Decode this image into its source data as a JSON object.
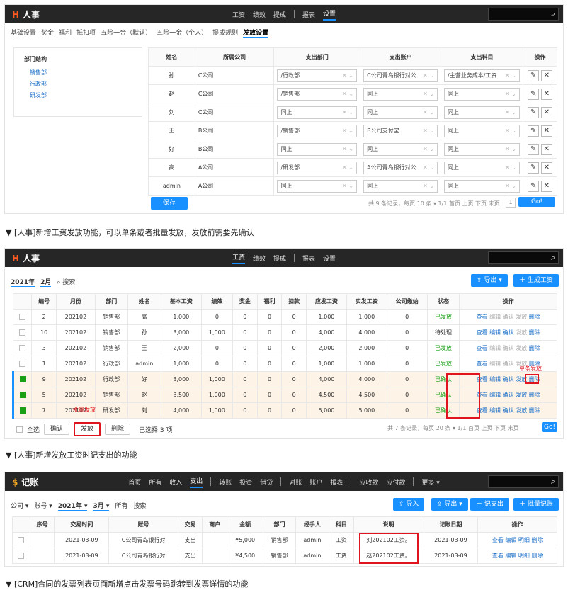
{
  "p1": {
    "logo": "人事",
    "nav": [
      "工资",
      "绩效",
      "提成",
      "报表",
      "设置"
    ],
    "active": "设置",
    "subtabs": [
      "基础设置",
      "奖金",
      "福利",
      "抵扣项",
      "五险一金（默认）",
      "五险一金（个人）",
      "提成规则",
      "发放设置"
    ],
    "active_tab": "发放设置",
    "tree_title": "部门结构",
    "tree_items": [
      "销售部",
      "行政部",
      "研发部"
    ],
    "headers": [
      "姓名",
      "所属公司",
      "支出部门",
      "支出账户",
      "支出科目",
      "操作"
    ],
    "rows": [
      [
        "孙",
        "C公司",
        "/行政部",
        "C公司青岛银行对公",
        "/主营业务成本/工资"
      ],
      [
        "赵",
        "C公司",
        "/销售部",
        "同上",
        "同上"
      ],
      [
        "刘",
        "C公司",
        "同上",
        "同上",
        "同上"
      ],
      [
        "王",
        "B公司",
        "/销售部",
        "B公司支付宝",
        "同上"
      ],
      [
        "好",
        "B公司",
        "同上",
        "同上",
        "同上"
      ],
      [
        "高",
        "A公司",
        "/研发部",
        "A公司青岛银行对公",
        "同上"
      ],
      [
        "admin",
        "A公司",
        "同上",
        "同上",
        "同上"
      ]
    ],
    "save": "保存",
    "pager": "共 9 条记录，每页 10 条 ▾ 1/1  首页 上页 下页 末页",
    "page_no": "1",
    "go": "Go!"
  },
  "cap1": "▼ [人事]新增工资发放功能，可以单条或者批量发放，发放前需要先确认",
  "p2": {
    "logo": "人事",
    "nav": [
      "工资",
      "绩效",
      "提成",
      "报表",
      "设置"
    ],
    "active": "工资",
    "year": "2021年",
    "month": "2月",
    "search": "搜索",
    "export": "导出",
    "generate": "生成工资",
    "headers": [
      "编号",
      "月份",
      "部门",
      "姓名",
      "基本工资",
      "绩效",
      "奖金",
      "福利",
      "扣款",
      "应发工资",
      "实发工资",
      "公司缴纳",
      "状态",
      "操作"
    ],
    "rows": [
      [
        "2",
        "202102",
        "销售部",
        "高",
        "1,000",
        "0",
        "0",
        "0",
        "0",
        "1,000",
        "1,000",
        "0",
        "已发放"
      ],
      [
        "10",
        "202102",
        "销售部",
        "孙",
        "3,000",
        "1,000",
        "0",
        "0",
        "0",
        "4,000",
        "4,000",
        "0",
        "待处理"
      ],
      [
        "3",
        "202102",
        "销售部",
        "王",
        "2,000",
        "0",
        "0",
        "0",
        "0",
        "2,000",
        "2,000",
        "0",
        "已发放"
      ],
      [
        "1",
        "202102",
        "行政部",
        "admin",
        "1,000",
        "0",
        "0",
        "0",
        "0",
        "1,000",
        "1,000",
        "0",
        "已发放"
      ],
      [
        "9",
        "202102",
        "行政部",
        "好",
        "3,000",
        "1,000",
        "0",
        "0",
        "0",
        "4,000",
        "4,000",
        "0",
        "已确认"
      ],
      [
        "5",
        "202102",
        "销售部",
        "赵",
        "3,500",
        "1,000",
        "0",
        "0",
        "0",
        "4,500",
        "4,500",
        "0",
        "已确认"
      ],
      [
        "7",
        "202102",
        "研发部",
        "刘",
        "4,000",
        "1,000",
        "0",
        "0",
        "0",
        "5,000",
        "5,000",
        "0",
        "已确认"
      ]
    ],
    "ops": [
      "查看",
      "编辑",
      "确认",
      "发放",
      "删除"
    ],
    "selectall": "全选",
    "confirm": "确认",
    "pay": "发放",
    "del": "删除",
    "selected": "已选择 3 项",
    "pager": "共 7 条记录，每页 20 条 ▾ 1/1  首页 上页 下页 末页",
    "page_no": "1",
    "go": "Go!",
    "note_single": "单条发放",
    "note_batch": "批量发放"
  },
  "cap2": "▼ [人事]新增发放工资时记支出的功能",
  "p3": {
    "logo": "记账",
    "nav": [
      "首页",
      "所有",
      "收入",
      "支出",
      "转账",
      "投资",
      "借贷",
      "对账",
      "账户",
      "报表",
      "应收款",
      "应付款",
      "更多 ▾"
    ],
    "active": "支出",
    "filters": [
      "公司 ▾",
      "账号 ▾",
      "2021年 ▾",
      "3月 ▾",
      "所有",
      "搜索"
    ],
    "import": "导入",
    "export": "导出",
    "add": "记支出",
    "batch": "批量记账",
    "headers": [
      "序号",
      "交易时间",
      "账号",
      "交易",
      "商户",
      "金额",
      "部门",
      "经手人",
      "科目",
      "说明",
      "记账日期",
      "操作"
    ],
    "rows": [
      [
        "",
        "2021-03-09",
        "C公司青岛银行对",
        "支出",
        "",
        "¥5,000",
        "销售部",
        "admin",
        "工资",
        "刘202102工资。",
        "2021-03-09"
      ],
      [
        "",
        "2021-03-09",
        "C公司青岛银行对",
        "支出",
        "",
        "¥4,500",
        "销售部",
        "admin",
        "工资",
        "赵202102工资。",
        "2021-03-09"
      ]
    ],
    "ops": [
      "查看",
      "编辑",
      "明细",
      "删除"
    ]
  },
  "cap3": "▼ [CRM]合同的发票列表页面新增点击发票号码跳转到发票详情的功能"
}
